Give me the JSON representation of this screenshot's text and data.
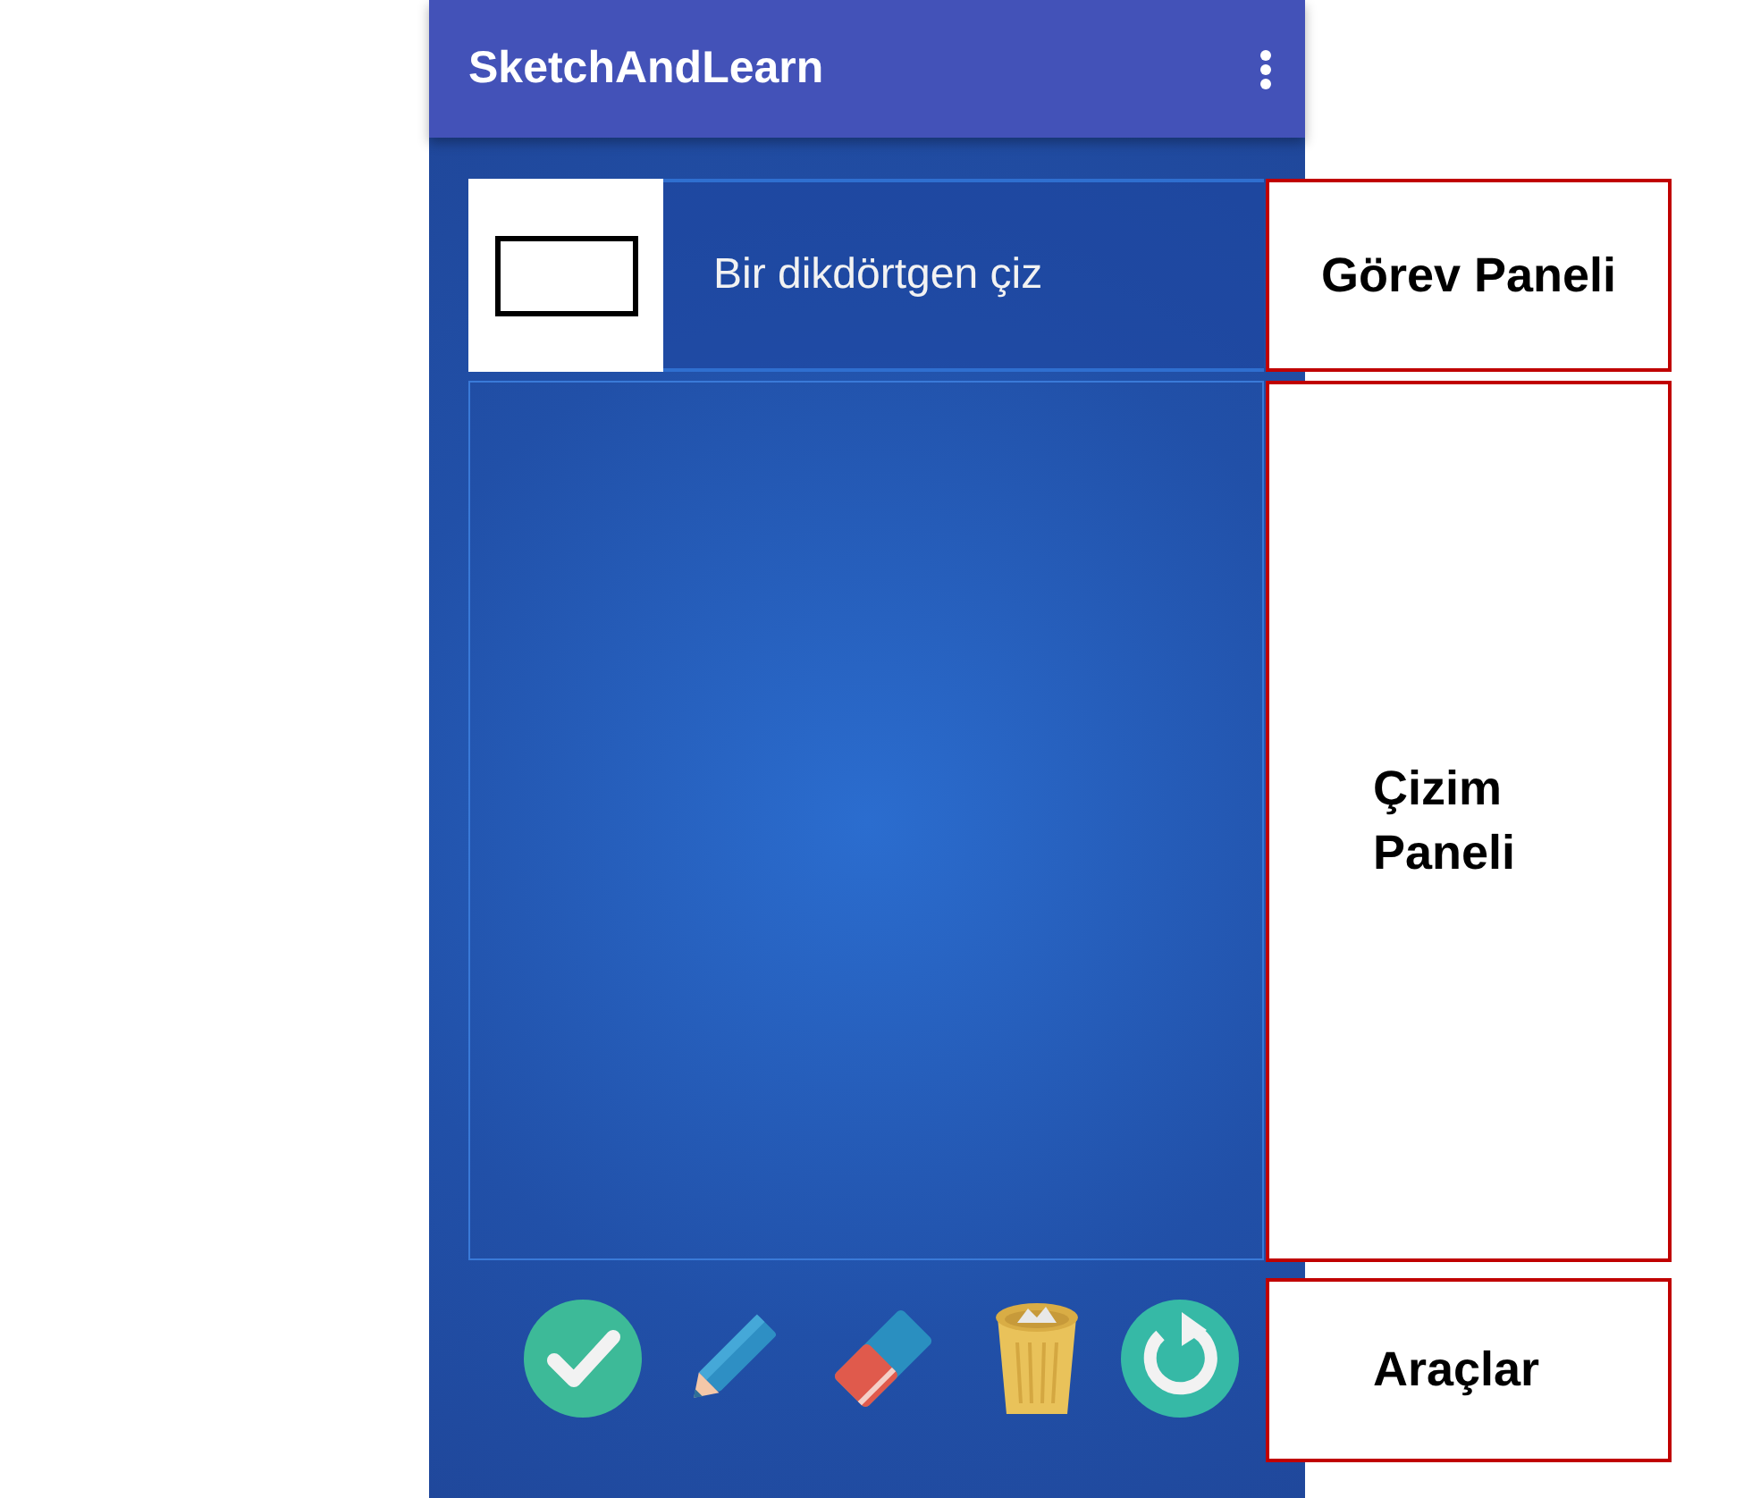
{
  "app_bar": {
    "title": "SketchAndLearn"
  },
  "task_panel": {
    "instruction": "Bir dikdörtgen çiz"
  },
  "tools": [
    {
      "kind": "check"
    },
    {
      "kind": "pencil"
    },
    {
      "kind": "eraser"
    },
    {
      "kind": "trash"
    },
    {
      "kind": "refresh"
    }
  ],
  "annotations": [
    {
      "label": "Görev Paneli"
    },
    {
      "label": "Çizim Paneli"
    },
    {
      "label": "Araçlar"
    }
  ]
}
